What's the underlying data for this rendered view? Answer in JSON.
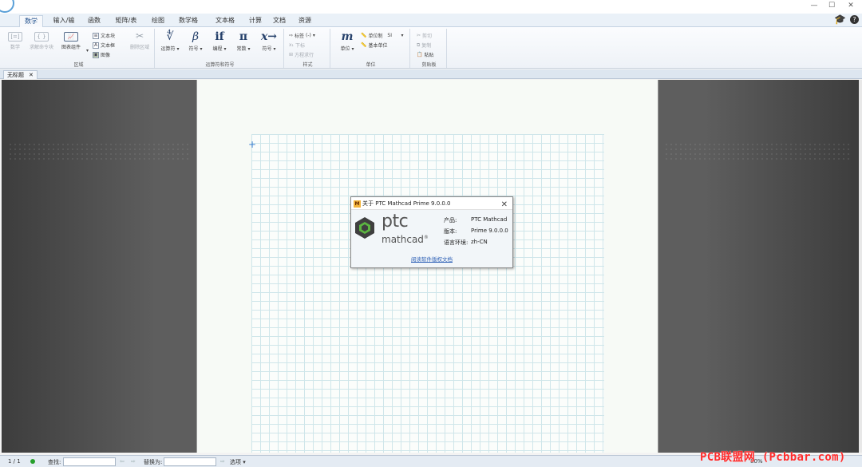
{
  "window": {
    "minimize": "—",
    "maximize": "☐",
    "close": "✕"
  },
  "ribbon_tabs": [
    {
      "label": "数学",
      "active": true
    },
    {
      "label": "输入/输出"
    },
    {
      "label": "函数"
    },
    {
      "label": "矩阵/表格"
    },
    {
      "label": "绘图"
    },
    {
      "label": "数学格式"
    },
    {
      "label": "文本格式"
    },
    {
      "label": "计算"
    },
    {
      "label": "文档"
    },
    {
      "label": "资源"
    }
  ],
  "ribbon": {
    "regions": {
      "label": "区域",
      "math": "数学",
      "solve_block": "求解命令块",
      "chart": "图表组件",
      "text_block": "文本块",
      "text_box": "文本框",
      "image": "图像",
      "delete_region": "删除区域"
    },
    "operators": {
      "label": "运算符和符号",
      "operators": "运算符",
      "symbols": "符号",
      "programming": "编程",
      "constants": "常数",
      "symbolic": "符号",
      "glyph_sqrt": "∜",
      "glyph_beta": "β",
      "glyph_if": "if",
      "glyph_pi": "π",
      "glyph_arrow": "x→"
    },
    "style": {
      "label": "样式",
      "label_btn": "标签",
      "label_value": "(-)",
      "subscript": "下标",
      "matrix_exec": "方程求行"
    },
    "units": {
      "label": "单位",
      "units_btn": "单位",
      "unit_system": "单位制",
      "unit_system_value": "SI",
      "base_units": "基本单位",
      "glyph_m": "m"
    },
    "clipboard": {
      "label": "剪贴板",
      "cut": "剪切",
      "copy": "复制",
      "paste": "粘贴"
    }
  },
  "doc_tab": {
    "title": "无标题",
    "close": "✕"
  },
  "about_dialog": {
    "title": "关于 PTC Mathcad Prime 9.0.0.0",
    "icon_letter": "M",
    "close": "✕",
    "logo_top": "ptc",
    "logo_bottom": "mathcad",
    "logo_reg": "®",
    "product_label": "产品:",
    "product_value": "PTC Mathcad",
    "version_label": "版本:",
    "version_value": "Prime 9.0.0.0",
    "locale_label": "语言环境:",
    "locale_value": "zh-CN",
    "license_link": "阅读软件版权文档"
  },
  "statusbar": {
    "page": "1 / 1",
    "find_label": "查找:",
    "replace_label": "替换为:",
    "options": "选项",
    "zoom": "80%"
  },
  "watermark": "PCB联盟网 (Pcbbar.com)"
}
